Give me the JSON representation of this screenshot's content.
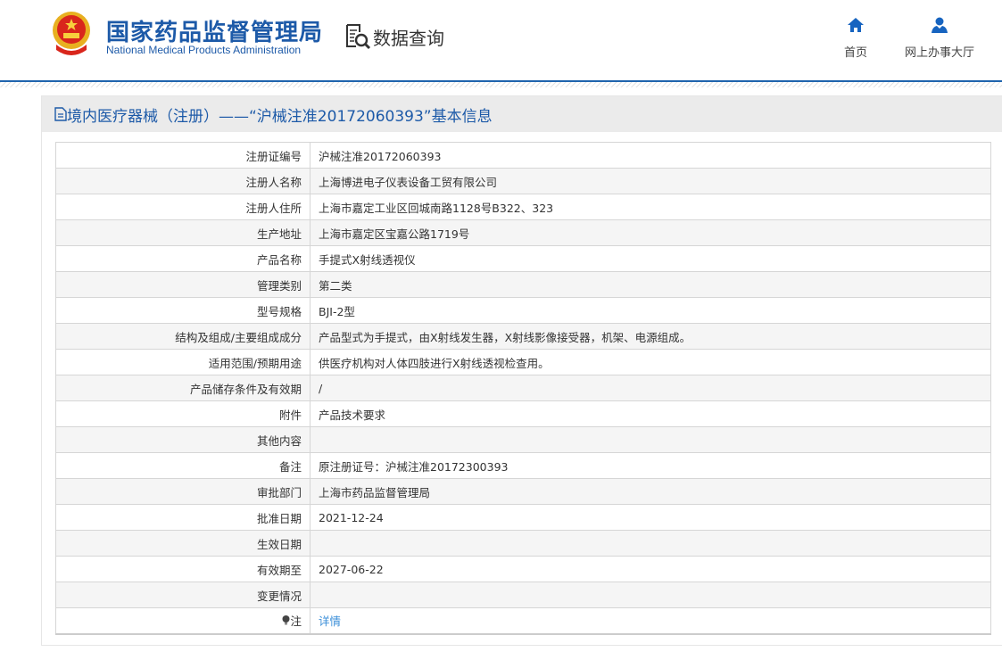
{
  "header": {
    "logo_cn": "国家药品监督管理局",
    "logo_en": "National Medical Products Administration",
    "section": "数据查询",
    "nav": [
      {
        "label": "首页",
        "icon": "home-icon"
      },
      {
        "label": "网上办事大厅",
        "icon": "user-icon"
      }
    ]
  },
  "panel": {
    "title": "境内医疗器械（注册）——“沪械注准20172060393”基本信息"
  },
  "rows": [
    {
      "label": "注册证编号",
      "value": "沪械注准20172060393"
    },
    {
      "label": "注册人名称",
      "value": "上海博进电子仪表设备工贸有限公司"
    },
    {
      "label": "注册人住所",
      "value": "上海市嘉定工业区回城南路1128号B322、323"
    },
    {
      "label": "生产地址",
      "value": "上海市嘉定区宝嘉公路1719号"
    },
    {
      "label": "产品名称",
      "value": "手提式X射线透视仪"
    },
    {
      "label": "管理类别",
      "value": "第二类"
    },
    {
      "label": "型号规格",
      "value": "BJI-2型"
    },
    {
      "label": "结构及组成/主要组成成分",
      "value": "产品型式为手提式，由X射线发生器，X射线影像接受器，机架、电源组成。"
    },
    {
      "label": "适用范围/预期用途",
      "value": "供医疗机构对人体四肢进行X射线透视检查用。"
    },
    {
      "label": "产品储存条件及有效期",
      "value": "/"
    },
    {
      "label": "附件",
      "value": "产品技术要求"
    },
    {
      "label": "其他内容",
      "value": ""
    },
    {
      "label": "备注",
      "value": "原注册证号：沪械注准20172300393"
    },
    {
      "label": "审批部门",
      "value": "上海市药品监督管理局"
    },
    {
      "label": "批准日期",
      "value": "2021-12-24"
    },
    {
      "label": "生效日期",
      "value": ""
    },
    {
      "label": "有效期至",
      "value": "2027-06-22"
    },
    {
      "label": "变更情况",
      "value": ""
    }
  ],
  "note": {
    "label": "注",
    "link": "详情"
  }
}
